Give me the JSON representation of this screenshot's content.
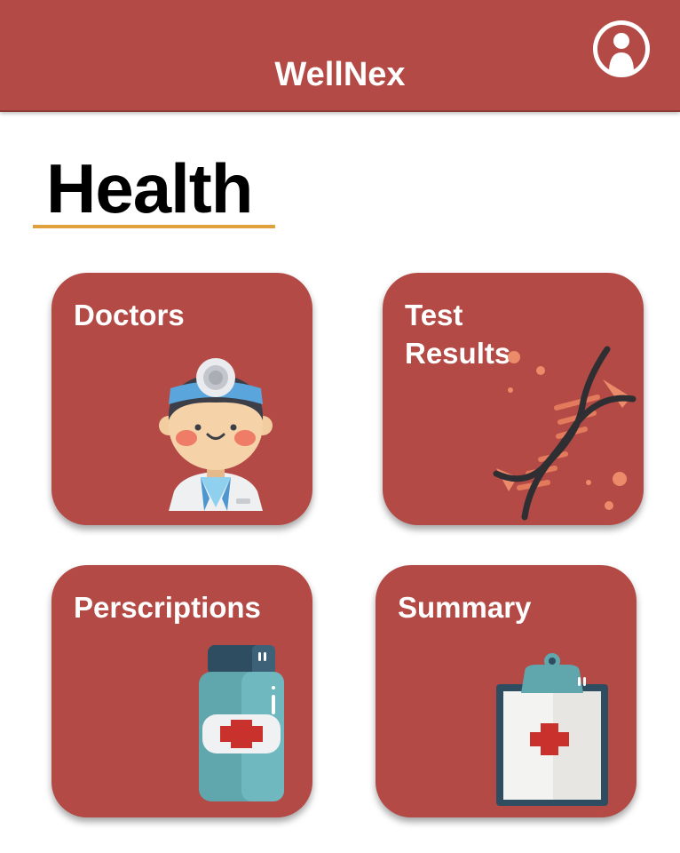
{
  "app": {
    "title": "WellNex"
  },
  "page": {
    "title": "Health"
  },
  "cards": [
    {
      "id": "doctors",
      "label": "Doctors",
      "icon": "doctor-icon"
    },
    {
      "id": "test-results",
      "label": "Test\nResults",
      "icon": "dna-icon"
    },
    {
      "id": "prescriptions",
      "label": "Perscriptions",
      "icon": "medicine-bottle-icon"
    },
    {
      "id": "summary",
      "label": "Summary",
      "icon": "clipboard-icon"
    }
  ],
  "colors": {
    "brand": "#b34a45",
    "accent_underline": "#e0a13c",
    "text_light": "#ffffff",
    "text_dark": "#000000"
  }
}
